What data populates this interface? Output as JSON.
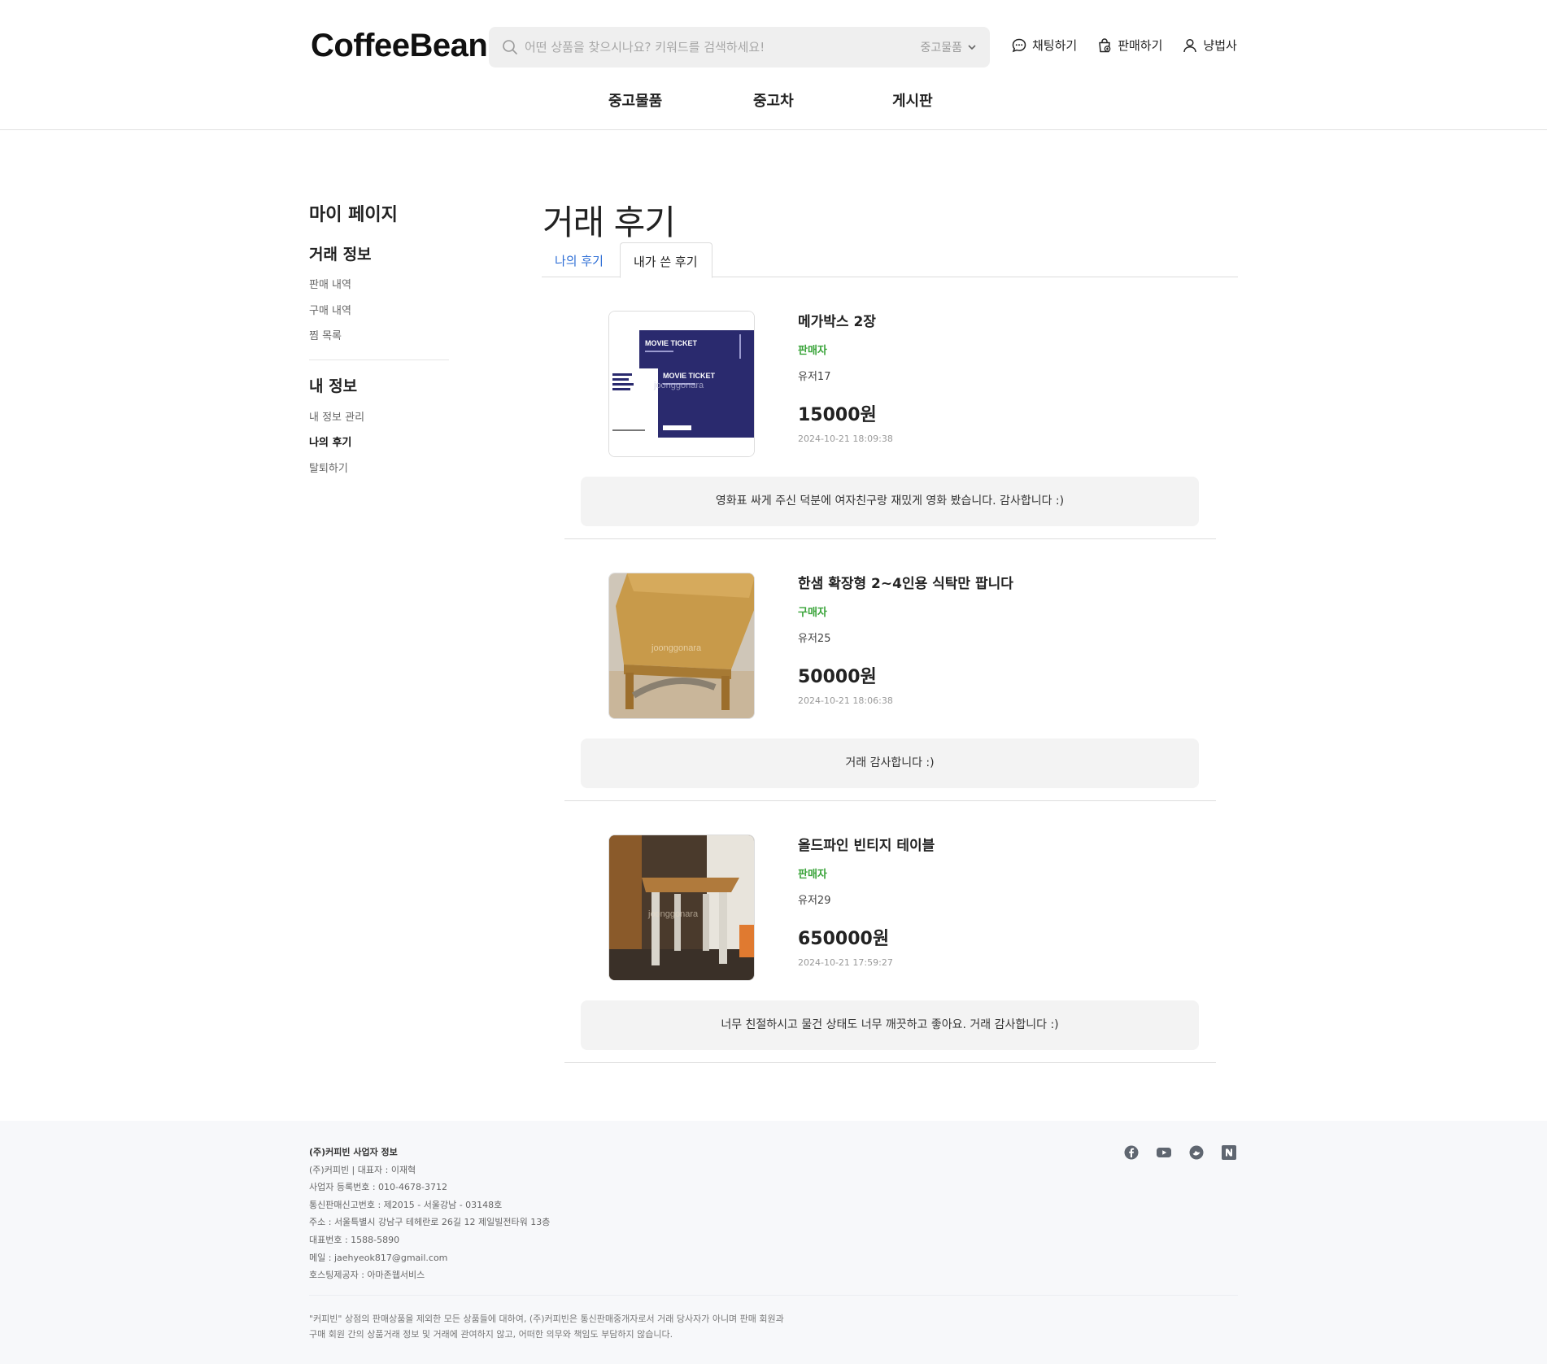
{
  "header": {
    "logo": "CoffeeBean",
    "search": {
      "placeholder": "어떤 상품을 찾으시나요? 키워드를 검색하세요!",
      "category": "중고물품"
    },
    "actions": {
      "chat": "채팅하기",
      "sell": "판매하기",
      "user": "냥법사"
    },
    "nav": [
      "중고물품",
      "중고차",
      "게시판"
    ]
  },
  "sidebar": {
    "title": "마이 페이지",
    "trade_section": "거래 정보",
    "trade_items": [
      "판매 내역",
      "구매 내역",
      "찜 목록"
    ],
    "my_section": "내 정보",
    "my_items": [
      "내 정보 관리",
      "나의 후기",
      "탈퇴하기"
    ]
  },
  "main": {
    "title": "거래 후기",
    "tabs": [
      "나의 후기",
      "내가 쓴 후기"
    ],
    "reviews": [
      {
        "title": "메가박스 2장",
        "role": "판매자",
        "user": "유저17",
        "price": "15000원",
        "date": "2024-10-21 18:09:38",
        "comment": "영화표 싸게 주신 덕분에 여자친구랑 재밌게 영화 봤습니다. 감사합니다 :)",
        "image": "movie-ticket-photo"
      },
      {
        "title": "한샘 확장형 2~4인용 식탁만 팝니다",
        "role": "구매자",
        "user": "유저25",
        "price": "50000원",
        "date": "2024-10-21 18:06:38",
        "comment": "거래 감사합니다 :)",
        "image": "wooden-table-photo"
      },
      {
        "title": "올드파인 빈티지 테이블",
        "role": "판매자",
        "user": "유저29",
        "price": "650000원",
        "date": "2024-10-21 17:59:27",
        "comment": "너무 친절하시고 물건 상태도 너무 깨끗하고 좋아요. 거래 감사합니다 :)",
        "image": "vintage-table-photo"
      }
    ],
    "ticket_text": {
      "movie_ticket": "MOVIE TICKET",
      "watermark": "joonggonara"
    }
  },
  "footer": {
    "company_title": "(주)커피빈 사업자 정보",
    "lines": [
      "(주)커피빈 | 대표자 : 이재혁",
      "사업자 등록번호 : 010-4678-3712",
      "통신판매신고번호 : 제2015 - 서울강남 - 03148호",
      "주소 : 서울특별시 강남구 테헤란로 26길 12 제일빌전타워 13층",
      "대표번호 : 1588-5890",
      "메일 : jaehyeok817@gmail.com",
      "호스팅제공자 : 아마존웹서비스"
    ],
    "notice_1": "\"커피빈\" 상점의 판매상품을 제외한 모든 상품들에 대하여, (주)커피빈은 통신판매중개자로서 거래 당사자가 아니며 판매 회원과",
    "notice_2": "구매 회원 간의 상품거래 정보 및 거래에 관여하지 않고, 어떠한 의무와 책임도 부담하지 않습니다.",
    "social": [
      "facebook-icon",
      "youtube-icon",
      "blog-icon",
      "naver-icon"
    ]
  },
  "colors": {
    "accent_blue": "#2f6fd6",
    "role_green": "#3aa43a",
    "ticket_navy": "#2a2a6e"
  }
}
